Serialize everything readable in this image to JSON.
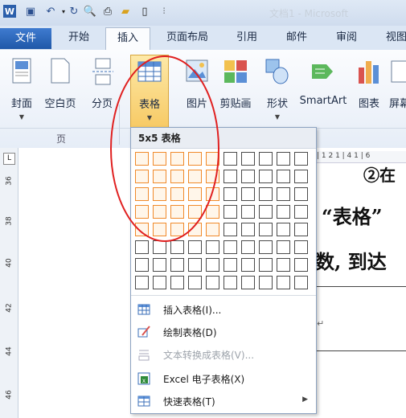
{
  "quick_access": {
    "app_icon": "word-icon",
    "title_text": "文档1 - Microsoft"
  },
  "tabs": {
    "file": "文件",
    "items": [
      "开始",
      "插入",
      "页面布局",
      "引用",
      "邮件",
      "审阅",
      "视图"
    ],
    "active": "插入"
  },
  "ribbon": {
    "buttons": [
      {
        "label": "封面",
        "icon": "cover-page-icon"
      },
      {
        "label": "空白页",
        "icon": "blank-page-icon"
      },
      {
        "label": "分页",
        "icon": "page-break-icon"
      },
      {
        "label": "表格",
        "icon": "table-icon"
      },
      {
        "label": "图片",
        "icon": "picture-icon"
      },
      {
        "label": "剪贴画",
        "icon": "clip-art-icon"
      },
      {
        "label": "形状",
        "icon": "shapes-icon"
      },
      {
        "label": "SmartArt",
        "icon": "smartart-icon"
      },
      {
        "label": "图表",
        "icon": "chart-icon"
      },
      {
        "label": "屏幕",
        "icon": "screenshot-icon"
      }
    ],
    "group_page_label": "页"
  },
  "ruler": {
    "vertical_numbers": [
      "36",
      "38",
      "40",
      "42",
      "44",
      "46"
    ],
    "horizontal_text": "| 1 2 1 | 4 1 | 6"
  },
  "document": {
    "line1": "②在",
    "line2": "“表格”",
    "line3": "数, 到达",
    "paragraph_mark": "↵"
  },
  "table_dropdown": {
    "header": "5x5 表格",
    "grid_cols": 10,
    "grid_rows": 8,
    "selected_cols": 5,
    "selected_rows": 5,
    "menu": [
      {
        "label": "插入表格(I)...",
        "icon": "insert-table-icon",
        "disabled": false,
        "submenu": false
      },
      {
        "label": "绘制表格(D)",
        "icon": "draw-table-icon",
        "disabled": false,
        "submenu": false
      },
      {
        "label": "文本转换成表格(V)...",
        "icon": "convert-text-icon",
        "disabled": true,
        "submenu": false
      },
      {
        "label": "Excel 电子表格(X)",
        "icon": "excel-icon",
        "disabled": false,
        "submenu": false
      },
      {
        "label": "快速表格(T)",
        "icon": "quick-table-icon",
        "disabled": false,
        "submenu": true
      }
    ]
  },
  "colors": {
    "highlight_border": "#f08a2b",
    "annotation": "#e02020",
    "file_tab": "#2b65b5"
  }
}
